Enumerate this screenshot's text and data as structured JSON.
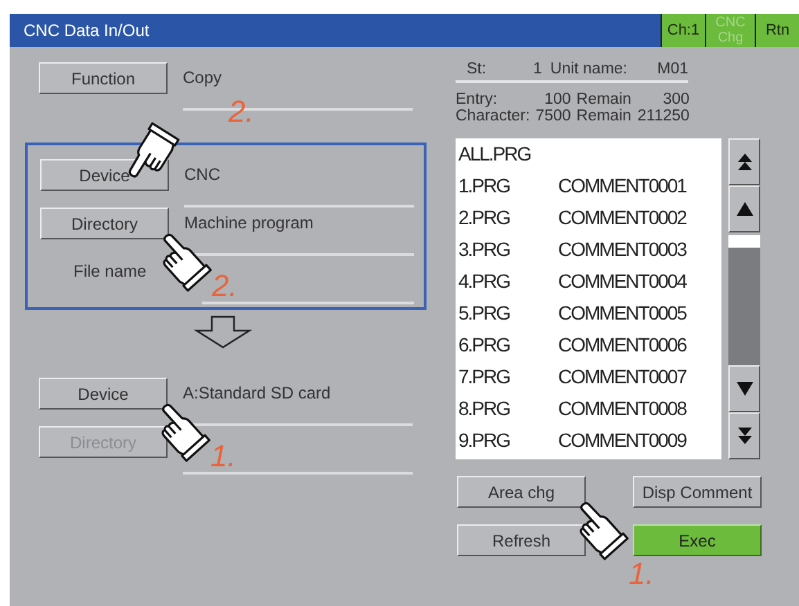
{
  "window": {
    "title": "CNC Data In/Out",
    "buttons": [
      {
        "label": "Ch:1",
        "disabled": false
      },
      {
        "label": "CNC Chg",
        "disabled": true
      },
      {
        "label": "Rtn",
        "disabled": false
      }
    ]
  },
  "function": {
    "button": {
      "label": "Function",
      "disabled": false
    },
    "value": "Copy"
  },
  "source": {
    "rows": [
      {
        "kind": "field",
        "button": {
          "label": "Device",
          "disabled": false,
          "pointer": {
            "kind": "above",
            "step": "2."
          }
        },
        "value": "CNC"
      },
      {
        "kind": "field",
        "button": {
          "label": "Directory",
          "disabled": false,
          "pointer": {
            "kind": "below",
            "step": "2."
          }
        },
        "value": "Machine program"
      },
      {
        "kind": "label",
        "label": "File name"
      }
    ]
  },
  "destination": {
    "rows": [
      {
        "kind": "field",
        "button": {
          "label": "Device",
          "disabled": false,
          "pointer": {
            "kind": "below",
            "step": "1."
          }
        },
        "value": "A:Standard SD card"
      },
      {
        "kind": "field",
        "button": {
          "label": "Directory",
          "disabled": true
        }
      }
    ]
  },
  "status": {
    "st_label": "St:",
    "st": "1",
    "unit_label": "Unit name:",
    "unit": "M01",
    "entry_label": "Entry:",
    "entry": "100",
    "entry_remain_label": "Remain",
    "entry_remain": "300",
    "character_label": "Character:",
    "character": "7500",
    "character_remain_label": "Remain",
    "character_remain": "211250"
  },
  "file_list": {
    "items": [
      {
        "name": "ALL.PRG"
      },
      {
        "name": "1.PRG",
        "comment": "COMMENT0001"
      },
      {
        "name": "2.PRG",
        "comment": "COMMENT0002"
      },
      {
        "name": "3.PRG",
        "comment": "COMMENT0003"
      },
      {
        "name": "4.PRG",
        "comment": "COMMENT0004"
      },
      {
        "name": "5.PRG",
        "comment": "COMMENT0005"
      },
      {
        "name": "6.PRG",
        "comment": "COMMENT0006"
      },
      {
        "name": "7.PRG",
        "comment": "COMMENT0007"
      },
      {
        "name": "8.PRG",
        "comment": "COMMENT0008"
      },
      {
        "name": "9.PRG",
        "comment": "COMMENT0009"
      }
    ]
  },
  "actions": [
    {
      "label": "Area chg",
      "highlighted": false,
      "pointer": {
        "kind": "below",
        "step": "1."
      }
    },
    {
      "label": "Disp Comment",
      "highlighted": false
    },
    {
      "label": "Refresh",
      "highlighted": false
    },
    {
      "label": "Exec",
      "highlighted": true
    }
  ]
}
